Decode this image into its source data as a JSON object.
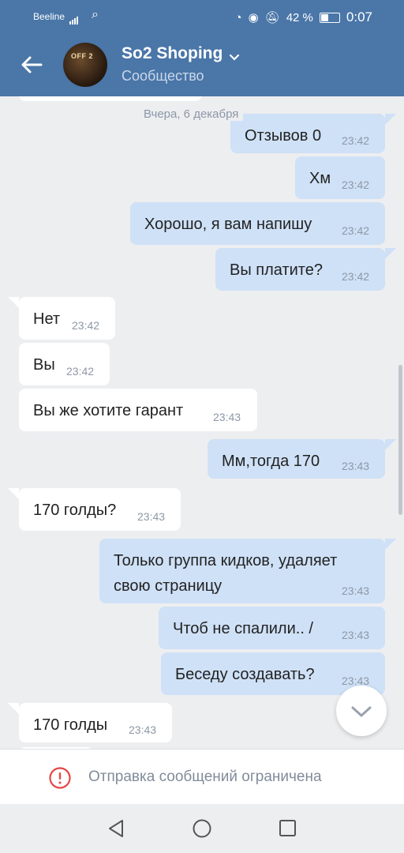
{
  "status_bar": {
    "carrier": "Beeline",
    "network": "4G",
    "battery": "42 %",
    "time": "0:07"
  },
  "header": {
    "title": "So2 Shoping",
    "subtitle": "Сообщество",
    "avatar_text": "OFF 2"
  },
  "chat": {
    "date_separator": "Вчера, 6 декабря",
    "messages": [
      {
        "dir": "out",
        "text": "Отзывов 0",
        "time": "23:42"
      },
      {
        "dir": "out",
        "text": "Хм",
        "time": "23:42"
      },
      {
        "dir": "out",
        "text": "Хорошо, я вам напишу",
        "time": "23:42"
      },
      {
        "dir": "out",
        "text": "Вы платите?",
        "time": "23:42"
      },
      {
        "dir": "in",
        "text": "Нет",
        "time": "23:42"
      },
      {
        "dir": "in",
        "text": "Вы",
        "time": "23:42"
      },
      {
        "dir": "in",
        "text": "Вы же хотите гарант",
        "time": "23:43"
      },
      {
        "dir": "out",
        "text": "Мм,тогда 170",
        "time": "23:43"
      },
      {
        "dir": "in",
        "text": "170 голды?",
        "time": "23:43"
      },
      {
        "dir": "out",
        "text": "Только группа кидков, удаляет\nсвою страницу",
        "time": "23:43"
      },
      {
        "dir": "out",
        "text": "Чтоб не спалили.. /",
        "time": "23:43"
      },
      {
        "dir": "out",
        "text": "Беседу создавать?",
        "time": "23:43"
      },
      {
        "dir": "in",
        "text": "170 голды",
        "time": "23:43"
      }
    ]
  },
  "restriction": {
    "text": "Отправка сообщений ограничена"
  },
  "icons": {
    "back": "arrow-left-icon",
    "dropdown": "chevron-down-icon",
    "scroll_down": "chevron-down-icon",
    "warning": "exclamation-circle-icon",
    "nav_back": "triangle-back-icon",
    "nav_home": "circle-home-icon",
    "nav_recent": "square-recent-icon"
  },
  "colors": {
    "header": "#4a76a8",
    "outgoing_bubble": "#cfe1f7",
    "incoming_bubble": "#ffffff",
    "background": "#edeef0",
    "warning": "#e64646"
  }
}
